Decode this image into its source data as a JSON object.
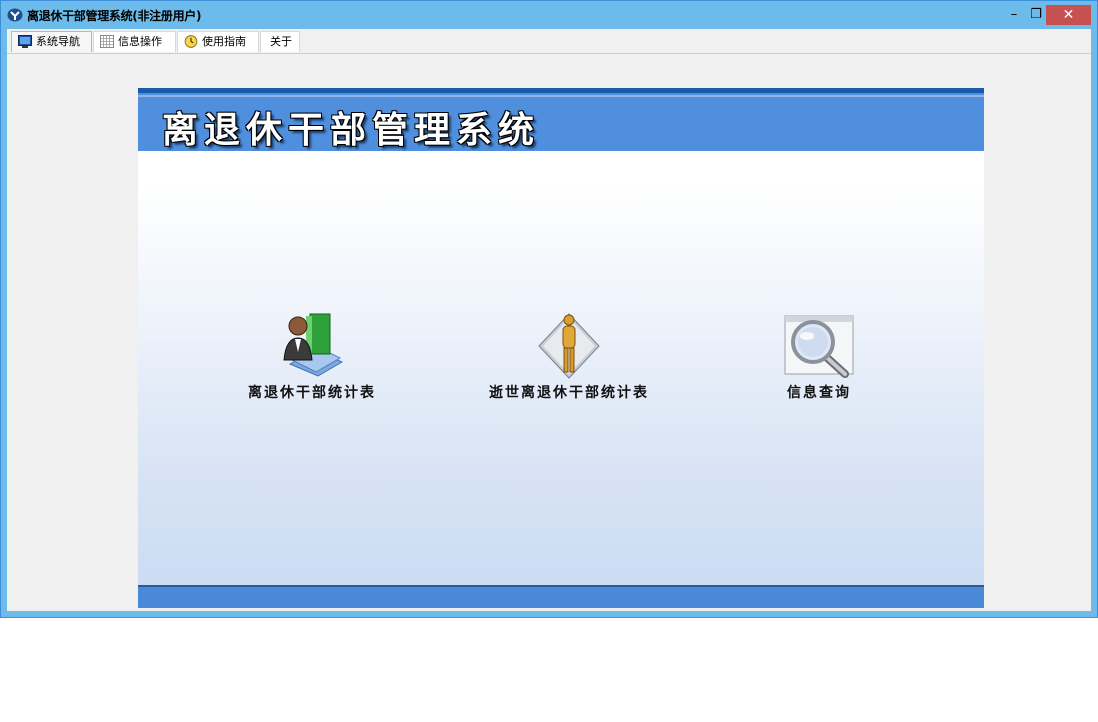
{
  "window": {
    "title": "离退休干部管理系统(非注册用户)",
    "minimize_label": "–",
    "restore_label": "❐",
    "close_label": "✕"
  },
  "tabs": [
    {
      "label": "系统导航",
      "icon": "monitor-icon",
      "active": true
    },
    {
      "label": "信息操作",
      "icon": "grid-icon",
      "active": false
    },
    {
      "label": "使用指南",
      "icon": "clock-icon",
      "active": false
    },
    {
      "label": "关于",
      "icon": "",
      "active": false
    }
  ],
  "banner": {
    "title": "离退休干部管理系统"
  },
  "features": [
    {
      "label": "离退休干部统计表",
      "icon": "person-book-icon"
    },
    {
      "label": "逝世离退休干部统计表",
      "icon": "person-diamond-icon"
    },
    {
      "label": "信息查询",
      "icon": "magnifier-icon"
    }
  ],
  "colors": {
    "titlebar": "#6cbbea",
    "close_button": "#c75050",
    "banner": "#4f8fdd",
    "footer": "#4a88d8"
  }
}
